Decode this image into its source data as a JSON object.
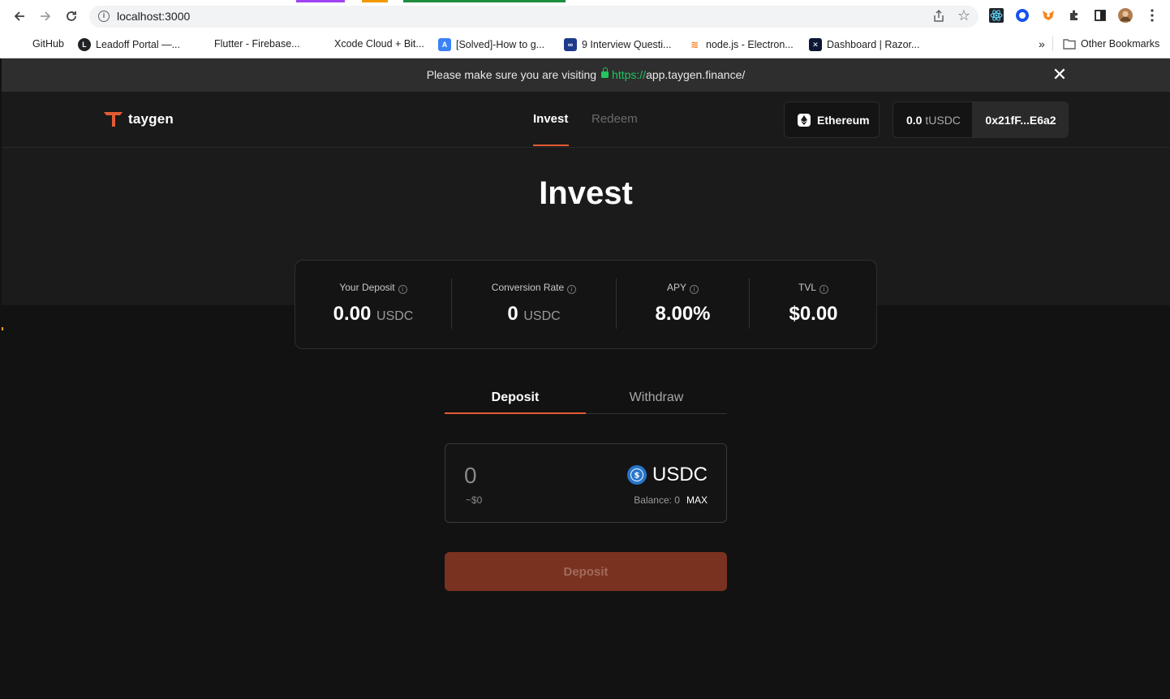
{
  "browser": {
    "url": "localhost:3000",
    "bookmarks": [
      {
        "label": "GitHub",
        "icon": "github-icon"
      },
      {
        "label": "Leadoff Portal —...",
        "icon": "leadoff-icon"
      },
      {
        "label": "Flutter - Firebase...",
        "icon": "flutter-icon"
      },
      {
        "label": "Xcode Cloud + Bit...",
        "icon": "xcode-icon"
      },
      {
        "label": "[Solved]-How to g...",
        "icon": "solved-icon"
      },
      {
        "label": "9 Interview Questi...",
        "icon": "interview-icon"
      },
      {
        "label": "node.js - Electron...",
        "icon": "stackoverflow-icon"
      },
      {
        "label": "Dashboard | Razor...",
        "icon": "razorpay-icon"
      }
    ],
    "overflow_label": "»",
    "other_bookmarks": "Other Bookmarks"
  },
  "notice": {
    "text": "Please make sure you are visiting",
    "url_scheme": "https://",
    "url_host": "app.taygen.finance/"
  },
  "header": {
    "logo_text": "taygen",
    "nav": [
      {
        "label": "Invest",
        "active": true
      },
      {
        "label": "Redeem",
        "active": false
      }
    ],
    "network": "Ethereum",
    "wallet_balance_value": "0.0",
    "wallet_balance_unit": "tUSDC",
    "wallet_address": "0x21fF...E6a2"
  },
  "page": {
    "title": "Invest"
  },
  "stats": [
    {
      "label": "Your Deposit",
      "value": "0.00",
      "unit": "USDC"
    },
    {
      "label": "Conversion Rate",
      "value": "0",
      "unit": "USDC"
    },
    {
      "label": "APY",
      "value": "8.00%",
      "unit": ""
    },
    {
      "label": "TVL",
      "value": "$0.00",
      "unit": ""
    }
  ],
  "tabs": [
    {
      "label": "Deposit",
      "active": true
    },
    {
      "label": "Withdraw",
      "active": false
    }
  ],
  "amount": {
    "placeholder": "0",
    "usd_estimate": "~$0",
    "token": "USDC",
    "balance_label": "Balance: 0",
    "max_label": "MAX"
  },
  "action": {
    "label": "Deposit"
  },
  "colors": {
    "accent": "#e25c34",
    "button_disabled": "#7a3220",
    "secure_green": "#22c55e"
  }
}
